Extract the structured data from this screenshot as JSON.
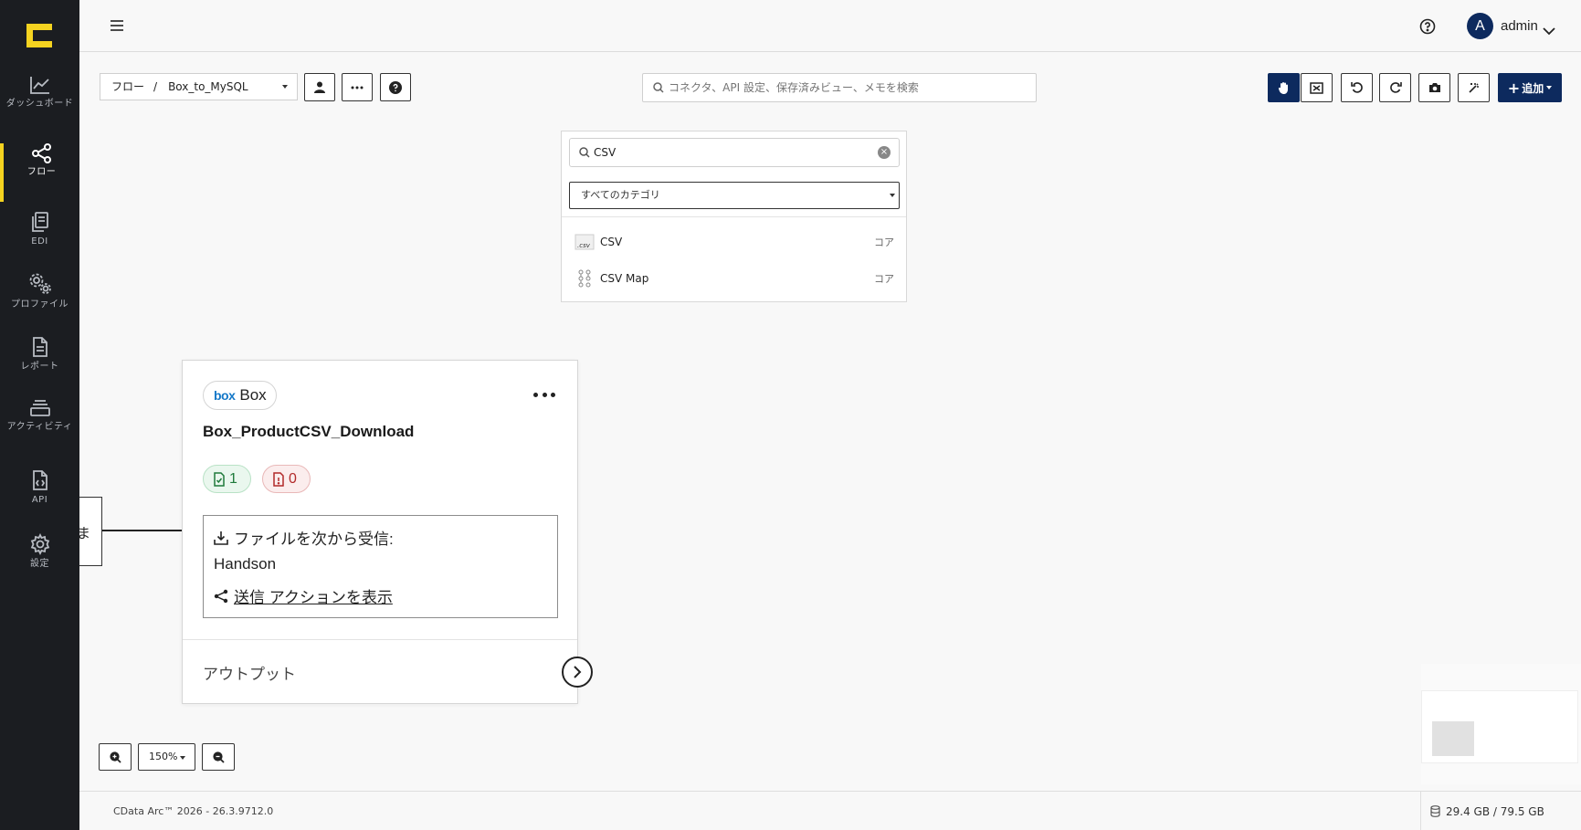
{
  "sidebar": {
    "items": [
      {
        "key": "dashboard",
        "label": "ダッシュボード",
        "icon": "chart-line-icon",
        "active": false
      },
      {
        "key": "flow",
        "label": "フロー",
        "icon": "share-nodes-icon",
        "active": true
      },
      {
        "key": "edi",
        "label": "EDI",
        "icon": "documents-icon",
        "active": false
      },
      {
        "key": "profile",
        "label": "プロファイル",
        "icon": "gears-icon",
        "active": false
      },
      {
        "key": "report",
        "label": "レポート",
        "icon": "file-text-icon",
        "active": false
      },
      {
        "key": "activity",
        "label": "アクティビティ",
        "icon": "layers-icon",
        "active": false
      },
      {
        "key": "api",
        "label": "API",
        "icon": "file-code-icon",
        "active": false
      },
      {
        "key": "settings",
        "label": "設定",
        "icon": "gear-icon",
        "active": false
      }
    ]
  },
  "header": {
    "avatar_initial": "A",
    "user_name": "admin"
  },
  "toolbar": {
    "breadcrumb_root": "フロー",
    "breadcrumb_sep": "/",
    "breadcrumb_current": "Box_to_MySQL",
    "search_placeholder": "コネクタ、API 設定、保存済みビュー、メモを検索",
    "add_label": "追加"
  },
  "connector_panel": {
    "search_value": "CSV",
    "category_selected": "すべてのカテゴリ",
    "items": [
      {
        "name": "CSV",
        "category": "コア",
        "icon": "csv-file-icon"
      },
      {
        "name": "CSV Map",
        "category": "コア",
        "icon": "map-tree-icon"
      }
    ]
  },
  "left_node": {
    "label_fragment": "ま"
  },
  "card": {
    "connector_label": "Box",
    "connector_logo": "box",
    "title": "Box_ProductCSV_Download",
    "success_count": "1",
    "error_count": "0",
    "receive_label": "ファイルを次から受信:",
    "receive_source": "Handson",
    "send_link": "送信 アクションを表示",
    "output_label": "アウトプット"
  },
  "zoom": {
    "level": "150%"
  },
  "footer": {
    "version": "CData Arc™ 2026 - 26.3.9712.0",
    "storage": "29.4 GB / 79.5 GB"
  },
  "colors": {
    "sidebar_bg": "#1b1d21",
    "accent_yellow": "#f5d320",
    "primary_navy": "#0d2a5e",
    "success_green": "#1f7a3b",
    "error_red": "#b22a2a"
  }
}
